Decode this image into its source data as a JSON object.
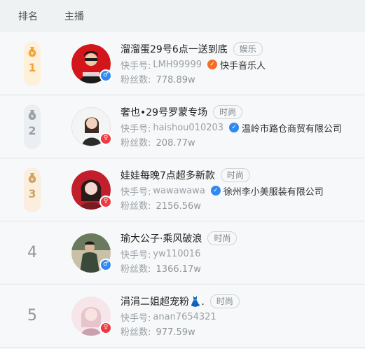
{
  "header": {
    "rank_label": "排名",
    "host_label": "主播"
  },
  "rows": [
    {
      "rank": "1",
      "medal": "gold",
      "name": "溜溜蛋29号6点一送到底",
      "tag": "娱乐",
      "id_label": "快手号:",
      "id": "LMH99999",
      "verify": "快手音乐人",
      "verify_color": "orange",
      "fans_label": "粉丝数:",
      "fans": "778.89w",
      "gender": "male",
      "avatar_colors": [
        "#d3161c",
        "#1b1b1b"
      ]
    },
    {
      "rank": "2",
      "medal": "silver",
      "name": "奢也•29号罗蒙专场",
      "tag": "时尚",
      "id_label": "快手号:",
      "id": "haishou010203",
      "verify": "温岭市路仓商贸有限公司",
      "verify_color": "blue",
      "fans_label": "粉丝数:",
      "fans": "208.77w",
      "gender": "female",
      "avatar_colors": [
        "#f1f1f1",
        "#2b2b2b"
      ]
    },
    {
      "rank": "3",
      "medal": "bronze",
      "name": "娃娃每晚7点超多新款",
      "tag": "时尚",
      "id_label": "快手号:",
      "id": "wawawawa",
      "verify": "徐州李小美服装有限公司",
      "verify_color": "blue",
      "fans_label": "粉丝数:",
      "fans": "2156.56w",
      "gender": "female",
      "avatar_colors": [
        "#c21e2c",
        "#f5d6d0"
      ]
    },
    {
      "rank": "4",
      "medal": "",
      "name": "瑜大公子·乘风破浪",
      "tag": "时尚",
      "id_label": "快手号:",
      "id": "yw110016",
      "verify": "",
      "verify_color": "",
      "fans_label": "粉丝数:",
      "fans": "1366.17w",
      "gender": "male",
      "avatar_colors": [
        "#3a4a3a",
        "#c9c0a8"
      ]
    },
    {
      "rank": "5",
      "medal": "",
      "name": "涓涓二姐超宠粉👗.",
      "tag": "时尚",
      "id_label": "快手号:",
      "id": "anan7654321",
      "verify": "",
      "verify_color": "",
      "fans_label": "粉丝数:",
      "fans": "977.59w",
      "gender": "female",
      "avatar_colors": [
        "#f6e6ea",
        "#c9a1ad"
      ]
    }
  ]
}
